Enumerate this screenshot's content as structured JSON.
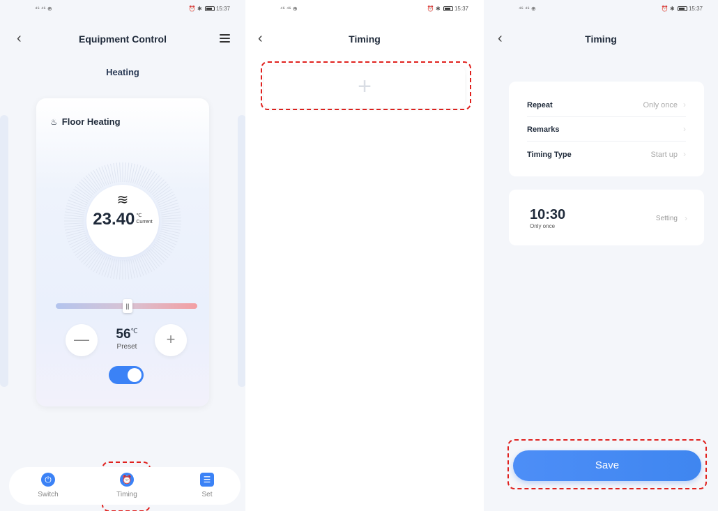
{
  "status": {
    "left": "⁴⁶ ⁴⁶ ⊕",
    "battery": "77%",
    "time": "15:37"
  },
  "screen1": {
    "title": "Equipment Control",
    "heading": "Heating",
    "card_title": "Floor Heating",
    "current_temp": "23.40",
    "current_unit": "℃",
    "current_label": "Current",
    "preset_value": "56",
    "preset_unit": "℃",
    "preset_label": "Preset",
    "minus": "—",
    "plus": "+",
    "toggle_on": true,
    "tabs": [
      {
        "label": "Switch",
        "icon": "power-icon"
      },
      {
        "label": "Timing",
        "icon": "alarm-clock-icon"
      },
      {
        "label": "Set",
        "icon": "sliders-icon"
      }
    ]
  },
  "screen2": {
    "title": "Timing",
    "add": "+"
  },
  "screen3": {
    "title": "Timing",
    "rows": [
      {
        "key": "Repeat",
        "value": "Only once"
      },
      {
        "key": "Remarks",
        "value": ""
      },
      {
        "key": "Timing Type",
        "value": "Start up"
      }
    ],
    "time": "10:30",
    "time_sub": "Only once",
    "setting": "Setting",
    "save": "Save"
  },
  "colors": {
    "accent": "#3b82f6",
    "highlight": "#e0211e"
  }
}
